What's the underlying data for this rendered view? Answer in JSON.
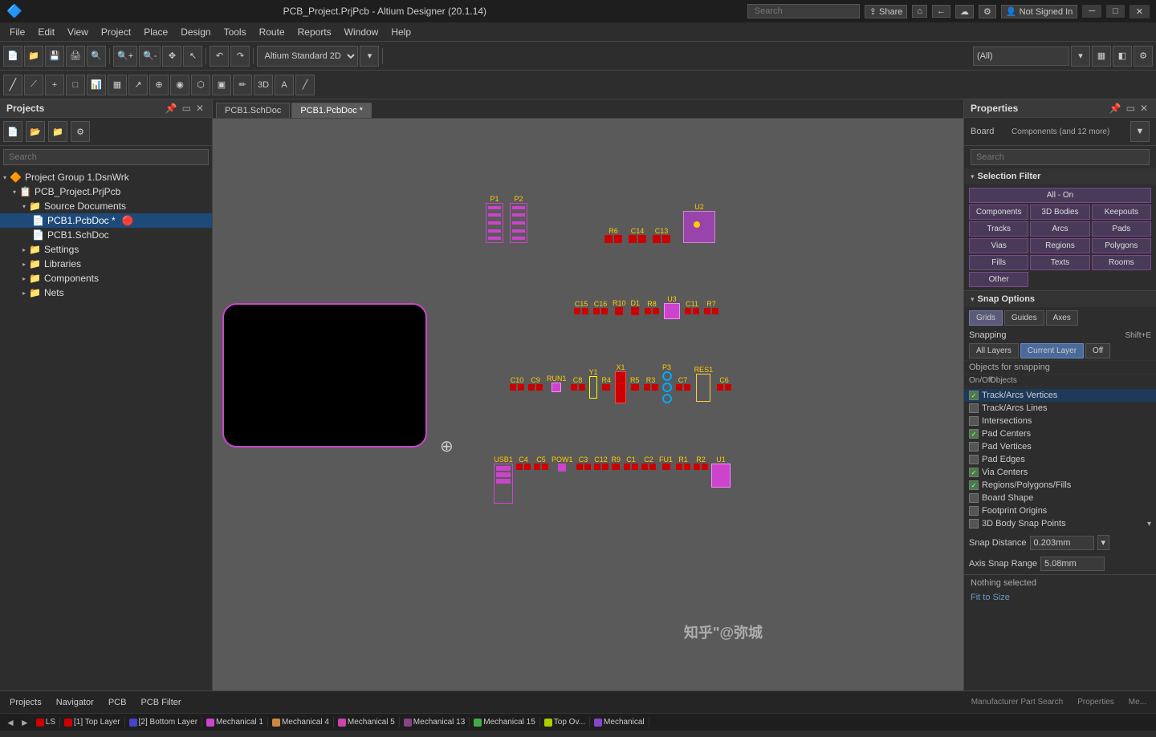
{
  "titlebar": {
    "title": "PCB_Project.PrjPcb - Altium Designer (20.1.14)",
    "search_placeholder": "Search",
    "share_label": "Share",
    "not_signed_in": "Not Signed In"
  },
  "menubar": {
    "items": [
      "File",
      "Edit",
      "View",
      "Project",
      "Place",
      "Design",
      "Tools",
      "Route",
      "Reports",
      "Window",
      "Help"
    ]
  },
  "toolbar1": {
    "view_dropdown": "Altium Standard 2D",
    "all_label": "(All)"
  },
  "tabs": {
    "items": [
      {
        "label": "PCB1.SchDoc",
        "active": false
      },
      {
        "label": "PCB1.PcbDoc *",
        "active": true
      }
    ]
  },
  "left_panel": {
    "title": "Projects",
    "search_placeholder": "Search",
    "tree": [
      {
        "label": "Project Group 1.DsnWrk",
        "indent": 0,
        "type": "group"
      },
      {
        "label": "PCB_Project.PrjPcb",
        "indent": 1,
        "type": "project",
        "expanded": true
      },
      {
        "label": "Source Documents",
        "indent": 2,
        "type": "folder",
        "expanded": true
      },
      {
        "label": "PCB1.PcbDoc *",
        "indent": 3,
        "type": "pcb",
        "selected": true
      },
      {
        "label": "PCB1.SchDoc",
        "indent": 3,
        "type": "sch"
      },
      {
        "label": "Settings",
        "indent": 2,
        "type": "folder"
      },
      {
        "label": "Libraries",
        "indent": 2,
        "type": "folder"
      },
      {
        "label": "Components",
        "indent": 2,
        "type": "folder"
      },
      {
        "label": "Nets",
        "indent": 2,
        "type": "folder"
      }
    ]
  },
  "right_panel": {
    "title": "Properties",
    "board_label": "Board",
    "components_label": "Components (and 12 more)",
    "search_placeholder": "Search",
    "selection_filter": {
      "title": "Selection Filter",
      "all_on": "All - On",
      "buttons": [
        "Components",
        "3D Bodies",
        "Keepouts",
        "Tracks",
        "Arcs",
        "Pads",
        "Vias",
        "Regions",
        "Polygons",
        "Fills",
        "Texts",
        "Rooms",
        "Other"
      ]
    },
    "snap_options": {
      "title": "Snap Options",
      "tabs": [
        "Grids",
        "Guides",
        "Axes"
      ],
      "snapping_label": "Snapping",
      "snapping_shortcut": "Shift+E",
      "snap_btns": [
        "All Layers",
        "Current Layer",
        "Off"
      ],
      "objects_header": "Objects for snapping",
      "on_off_label": "On/Off",
      "objects_label": "Objects",
      "snap_objects": [
        {
          "label": "Track/Arcs Vertices",
          "checked": true,
          "selected": true
        },
        {
          "label": "Track/Arcs Lines",
          "checked": false
        },
        {
          "label": "Intersections",
          "checked": false
        },
        {
          "label": "Pad Centers",
          "checked": true
        },
        {
          "label": "Pad Vertices",
          "checked": false
        },
        {
          "label": "Pad Edges",
          "checked": false
        },
        {
          "label": "Via Centers",
          "checked": true
        },
        {
          "label": "Regions/Polygons/Fills",
          "checked": true
        },
        {
          "label": "Board Shape",
          "checked": false
        },
        {
          "label": "Footprint Origins",
          "checked": false
        },
        {
          "label": "3D Body Snap Points",
          "checked": false
        }
      ],
      "snap_distance_label": "Snap Distance",
      "snap_distance_value": "0.203mm",
      "axis_snap_label": "Axis Snap Range",
      "axis_snap_value": "5.08mm"
    },
    "nothing_selected": "Nothing selected",
    "fit_to_size": "Fit to Size"
  },
  "status_bar": {
    "tabs": [
      "Projects",
      "Navigator",
      "PCB",
      "PCB Filter"
    ]
  },
  "layer_bar": {
    "layers": [
      {
        "label": "LS",
        "color": "#cc0000"
      },
      {
        "label": "[1] Top Layer",
        "color": "#cc0000"
      },
      {
        "label": "[2] Bottom Layer",
        "color": "#0000cc"
      },
      {
        "label": "Mechanical 1",
        "color": "#cc44cc"
      },
      {
        "label": "Mechanical 4",
        "color": "#cc8800"
      },
      {
        "label": "Mechanical 5",
        "color": "#cc44aa"
      },
      {
        "label": "Mechanical 13",
        "color": "#884488"
      },
      {
        "label": "Mechanical 15",
        "color": "#44aa44"
      },
      {
        "label": "Top Ov...",
        "color": "#aacc00"
      },
      {
        "label": "Me...",
        "color": "#8844cc"
      }
    ]
  },
  "pcb_components": {
    "row1": [
      {
        "label": "P1"
      },
      {
        "label": "P2"
      },
      {
        "label": "R6"
      },
      {
        "label": "U2"
      },
      {
        "label": "C14"
      },
      {
        "label": "C13"
      }
    ],
    "row2": [
      {
        "label": "C15"
      },
      {
        "label": "C16"
      },
      {
        "label": "R10"
      },
      {
        "label": "D1"
      },
      {
        "label": "R8"
      },
      {
        "label": "U3"
      },
      {
        "label": "C11"
      },
      {
        "label": "R7"
      }
    ],
    "row3": [
      {
        "label": "C10"
      },
      {
        "label": "C9"
      },
      {
        "label": "RUN1"
      },
      {
        "label": "C8"
      },
      {
        "label": "Y1"
      },
      {
        "label": "R4"
      },
      {
        "label": "X1"
      },
      {
        "label": "R5"
      },
      {
        "label": "R3"
      },
      {
        "label": "P3"
      },
      {
        "label": "C7"
      },
      {
        "label": "RES1"
      },
      {
        "label": "C6"
      }
    ],
    "row4": [
      {
        "label": "USB1"
      },
      {
        "label": "C4"
      },
      {
        "label": "C5"
      },
      {
        "label": "POW1"
      },
      {
        "label": "C3"
      },
      {
        "label": "C12"
      },
      {
        "label": "R9"
      },
      {
        "label": "C1"
      },
      {
        "label": "C2"
      },
      {
        "label": "FU1"
      },
      {
        "label": "R1"
      },
      {
        "label": "R2"
      },
      {
        "label": "U1"
      }
    ]
  },
  "icons": {
    "search": "🔍",
    "share": "⇪",
    "home": "⌂",
    "settings": "⚙",
    "user": "👤",
    "arrow_left": "‹",
    "arrow_right": "›",
    "close": "✕",
    "pin": "📌",
    "chevron_down": "▾",
    "chevron_right": "▸",
    "arrow_down": "▼",
    "minimize": "─",
    "maximize": "□",
    "expand": "▸",
    "collapse": "▾",
    "filter": "▼",
    "check": "✓"
  }
}
